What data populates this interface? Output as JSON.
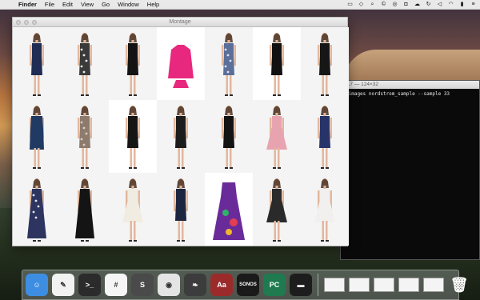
{
  "menubar": {
    "apple": "",
    "items": [
      "Finder",
      "File",
      "Edit",
      "View",
      "Go",
      "Window",
      "Help"
    ],
    "status_icons": [
      "menu-extra-icon",
      "dropbox-icon",
      "search-icon",
      "copyright-icon",
      "ring-icon",
      "camera-icon",
      "cloud-icon",
      "sync-icon",
      "mute-icon",
      "wifi-icon",
      "battery-icon",
      "list-icon"
    ]
  },
  "montage": {
    "title": "Montage",
    "rows": [
      [
        {
          "dress": "#1f2d55",
          "style": "sheath",
          "bg": "#f4f4f4"
        },
        {
          "dress": "#3a3a3a",
          "style": "printed",
          "bg": "#f4f4f4",
          "pattern": "#ececec"
        },
        {
          "dress": "#141414",
          "style": "sheath",
          "bg": "#f4f4f4"
        },
        {
          "dress": "#e8287e",
          "style": "kids",
          "bg": "#ffffff"
        },
        {
          "dress": "#5a6f9a",
          "style": "printed",
          "bg": "#f4f4f4",
          "pattern": "#e6e0ee"
        },
        {
          "dress": "#111111",
          "style": "sheath",
          "bg": "#ffffff"
        },
        {
          "dress": "#161616",
          "style": "sheath",
          "bg": "#f4f4f4"
        }
      ],
      [
        {
          "dress": "#213a63",
          "style": "wrap",
          "bg": "#f4f4f4"
        },
        {
          "dress": "#8d7b6d",
          "style": "printed",
          "bg": "#f4f4f4",
          "pattern": "#d9cfc4"
        },
        {
          "dress": "#151515",
          "style": "sheath",
          "bg": "#ffffff"
        },
        {
          "dress": "#1c1c1c",
          "style": "sheath",
          "bg": "#f4f4f4"
        },
        {
          "dress": "#131313",
          "style": "sheath",
          "bg": "#f4f4f4"
        },
        {
          "dress": "#e8a3b0",
          "style": "flare",
          "bg": "#f4f4f4"
        },
        {
          "dress": "#27346a",
          "style": "sheath",
          "bg": "#f4f4f4"
        }
      ],
      [
        {
          "dress": "#2d3460",
          "style": "maxi",
          "bg": "#f4f4f4",
          "pattern": "#e6e6f2"
        },
        {
          "dress": "#141414",
          "style": "maxi",
          "bg": "#f4f4f4"
        },
        {
          "dress": "#f1ece2",
          "style": "flare",
          "bg": "#f4f4f4"
        },
        {
          "dress": "#1c2540",
          "style": "sheath",
          "bg": "#f4f4f4"
        },
        {
          "dress": "#6a2b9a",
          "style": "flat",
          "bg": "#ffffff",
          "pattern": "#2fb36a"
        },
        {
          "dress": "#2a2a2a",
          "style": "flare",
          "bg": "#f4f4f4"
        },
        {
          "dress": "#f2f0ee",
          "style": "flare",
          "bg": "#f4f4f4"
        }
      ]
    ]
  },
  "terminal": {
    "title": "2.7 — 124×32",
    "command": "-images nordstrom_sample --sample 33"
  },
  "dock": {
    "apps": [
      {
        "name": "finder-icon",
        "bg": "#3d8ee3",
        "glyph": "☺"
      },
      {
        "name": "textedit-icon",
        "bg": "#f2f2f2",
        "glyph": "✎"
      },
      {
        "name": "terminal-icon",
        "bg": "#2b2b2b",
        "glyph": ">_"
      },
      {
        "name": "slack-icon",
        "bg": "#f5f5f5",
        "glyph": "#"
      },
      {
        "name": "sublime-icon",
        "bg": "#4a4a4a",
        "glyph": "S"
      },
      {
        "name": "chrome-icon",
        "bg": "#e4e4e4",
        "glyph": "◉"
      },
      {
        "name": "evernote-icon",
        "bg": "#3c3c3c",
        "glyph": "❧"
      },
      {
        "name": "dictionary-icon",
        "bg": "#9b2b2b",
        "glyph": "Aa"
      },
      {
        "name": "sonos-icon",
        "bg": "#1a1a1a",
        "glyph": "SONOS"
      },
      {
        "name": "pycharm-icon",
        "bg": "#1f7a4f",
        "glyph": "PC"
      },
      {
        "name": "terminal-2-icon",
        "bg": "#1d1d1d",
        "glyph": "▬"
      }
    ],
    "trash": {
      "name": "trash-icon",
      "glyph": "🗑"
    }
  },
  "colors": {
    "menubar": "#e9e9e9",
    "terminal_bg": "#0a0a0a"
  }
}
